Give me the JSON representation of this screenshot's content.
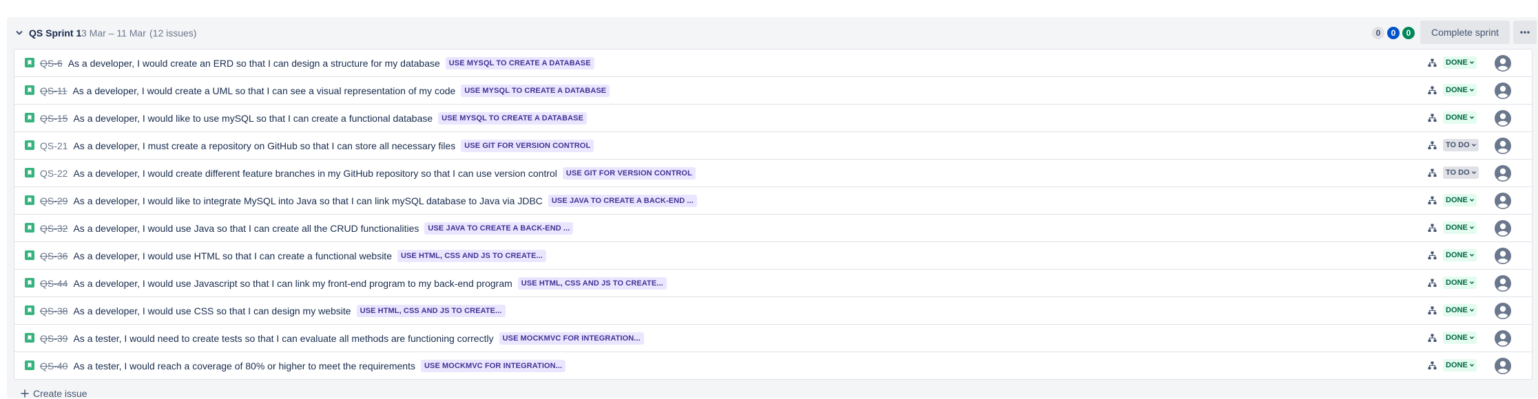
{
  "sprint": {
    "name": "QS Sprint 1",
    "dates": "3 Mar – 11 Mar",
    "issue_count": "(12 issues)",
    "counts": {
      "todo": "0",
      "in_progress": "0",
      "done": "0"
    },
    "complete_label": "Complete sprint",
    "more_icon": "more-horizontal-icon"
  },
  "colors": {
    "accent": "#0052cc",
    "done_bg": "#e3fcef",
    "done_text": "#006644",
    "todo_bg": "#dfe1e6",
    "todo_text": "#42526e",
    "epic_bg": "#eae6ff",
    "epic_text": "#403294",
    "story": "#36b37e"
  },
  "issues": [
    {
      "key": "QS-6",
      "summary": "As a developer, I would create an ERD so that I can design a structure for my database",
      "epic": "USE MYSQL TO CREATE A DATABASE",
      "status": "DONE"
    },
    {
      "key": "QS-11",
      "summary": "As a developer, I would create a UML so that I can see a visual representation of my code",
      "epic": "USE MYSQL TO CREATE A DATABASE",
      "status": "DONE"
    },
    {
      "key": "QS-15",
      "summary": "As a developer, I would like to use mySQL so that I can create a functional database",
      "epic": "USE MYSQL TO CREATE A DATABASE",
      "status": "DONE"
    },
    {
      "key": "QS-21",
      "summary": "As a developer, I must create a repository on GitHub so that I can store all necessary files",
      "epic": "USE GIT FOR VERSION CONTROL",
      "status": "TO DO"
    },
    {
      "key": "QS-22",
      "summary": "As a developer, I would create different feature branches in my GitHub repository so that I can use version control",
      "epic": "USE GIT FOR VERSION CONTROL",
      "status": "TO DO"
    },
    {
      "key": "QS-29",
      "summary": "As a developer, I would like to integrate MySQL into Java so that I can link mySQL database to Java via JDBC",
      "epic": "USE JAVA TO CREATE A BACK-END ...",
      "status": "DONE"
    },
    {
      "key": "QS-32",
      "summary": "As a developer, I would use Java so that I can create all the CRUD functionalities",
      "epic": "USE JAVA TO CREATE A BACK-END ...",
      "status": "DONE"
    },
    {
      "key": "QS-36",
      "summary": "As a developer, I would use HTML so that I can create a functional website",
      "epic": "USE HTML, CSS AND JS TO CREATE...",
      "status": "DONE"
    },
    {
      "key": "QS-44",
      "summary": "As a developer, I would use Javascript so that I can link my front-end program to my back-end program",
      "epic": "USE HTML, CSS AND JS TO CREATE...",
      "status": "DONE"
    },
    {
      "key": "QS-38",
      "summary": "As a developer, I would use CSS so that I can design my website",
      "epic": "USE HTML, CSS AND JS TO CREATE...",
      "status": "DONE"
    },
    {
      "key": "QS-39",
      "summary": "As a tester, I would need to create tests so that I can evaluate all methods are functioning correctly",
      "epic": "USE MOCKMVC FOR INTEGRATION...",
      "status": "DONE"
    },
    {
      "key": "QS-40",
      "summary": "As a tester, I would reach a coverage of 80% or higher to meet the requirements",
      "epic": "USE MOCKMVC FOR INTEGRATION...",
      "status": "DONE"
    }
  ],
  "create_issue_label": "Create issue"
}
